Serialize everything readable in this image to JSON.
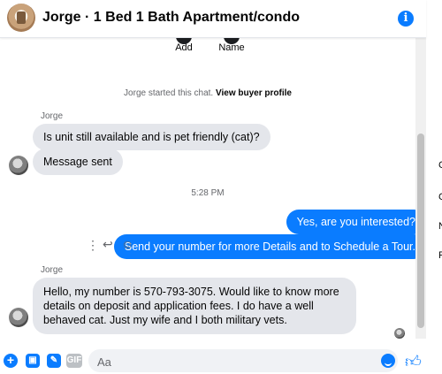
{
  "header": {
    "title": "Jorge · 1 Bed 1 Bath Apartment/condo",
    "info_icon": "info-icon"
  },
  "actions": [
    {
      "label": "Add"
    },
    {
      "label": "Name"
    }
  ],
  "system": {
    "started": "Jorge started this chat.",
    "view_profile": "View buyer profile",
    "timestamp": "5:28 PM"
  },
  "messages": {
    "in1_sender": "Jorge",
    "in1a": "Is unit still available and is pet friendly (cat)?",
    "in1b": "Message sent",
    "out1": "Yes, are you interested?",
    "out2": "Send your number for more Details and to Schedule a Tour.",
    "in2_sender": "Jorge",
    "in2": "Hello, my number is 570-793-3075. Would like to know more details on deposit and application fees. I do have a well behaved cat. Just my wife and I both military vets."
  },
  "message_tools": {
    "more_icon": "⋮",
    "reply_icon": "↩",
    "react_icon": "☺"
  },
  "composer": {
    "placeholder": "Aa",
    "gif_label": "GIF"
  },
  "right_panel_letters": [
    "C",
    "C",
    "N",
    "P"
  ],
  "colors": {
    "accent": "#0a7cff",
    "incoming_bubble": "#e4e6eb"
  }
}
